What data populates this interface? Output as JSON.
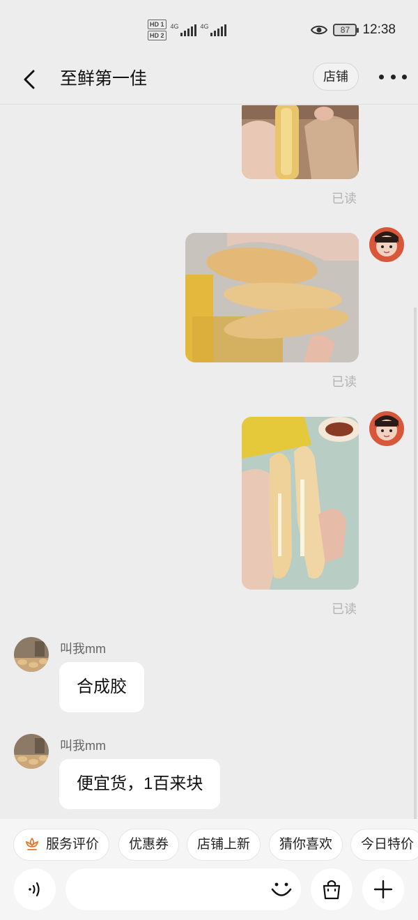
{
  "status_bar": {
    "time": "12:38",
    "battery": "87",
    "sim1_label": "HD 1",
    "sim2_label": "HD 2",
    "net1": "4G",
    "net2": "4G"
  },
  "nav": {
    "title": "至鲜第一佳",
    "shop_label": "店铺"
  },
  "messages": [
    {
      "type": "image",
      "side": "right",
      "icon": "fish-maw-photo",
      "read_label": "已读"
    },
    {
      "type": "image",
      "side": "right",
      "icon": "fish-maw-photo",
      "read_label": "已读"
    },
    {
      "type": "image",
      "side": "right",
      "icon": "fish-maw-photo",
      "read_label": "已读"
    },
    {
      "type": "text",
      "side": "left",
      "sender": "叫我mm",
      "text": "合成胶"
    },
    {
      "type": "text",
      "side": "left",
      "sender": "叫我mm",
      "text": "便宜货，1百来块"
    }
  ],
  "quick_actions": [
    {
      "label": "服务评价",
      "icon": "flower-icon"
    },
    {
      "label": "优惠券"
    },
    {
      "label": "店铺上新"
    },
    {
      "label": "猜你喜欢"
    },
    {
      "label": "今日特价"
    }
  ],
  "input_bar": {
    "placeholder": "",
    "voice_icon": "voice-icon",
    "emoji_icon": "emoji-icon",
    "bag_icon": "shopping-bag-icon",
    "plus_icon": "plus-icon"
  },
  "colors": {
    "background": "#ededed",
    "bubble": "#ffffff",
    "read_text": "#b3b3b3",
    "accent_orange": "#e8742c"
  }
}
